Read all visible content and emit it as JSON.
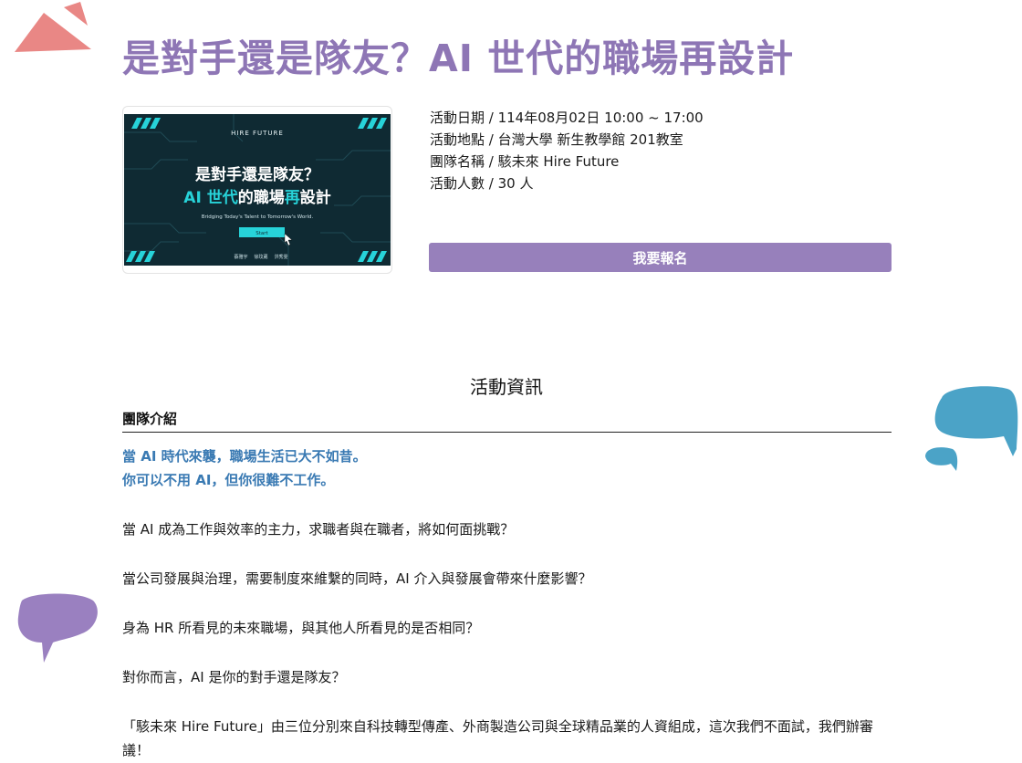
{
  "page": {
    "title": "是對手還是隊友？AI 世代的職場再設計"
  },
  "banner": {
    "brand": "HIRE FUTURE",
    "line1": "是對手還是隊友？",
    "line2_prefix": "AI ",
    "line2_highlight": "世代",
    "line2_mid": "的職場",
    "line2_highlight2": "再",
    "line2_suffix": "設計",
    "tagline": "Bridging Today's Talent to Tomorrow's World.",
    "start_label": "Start",
    "names": [
      "蔡雅宇",
      "徐玟葳",
      "洪秀雯"
    ]
  },
  "info": {
    "date": "活動日期 / 114年08月02日 10:00 ~ 17:00",
    "location": "活動地點 / 台灣大學 新生教學館 201教室",
    "team": "團隊名稱 / 駭未來 Hire Future",
    "capacity": "活動人數 / 30 人"
  },
  "register_label": "我要報名",
  "section_title": "活動資訊",
  "team_intro_heading": "團隊介紹",
  "intro": {
    "highlight1": "當 AI 時代來襲，職場生活已大不如昔。",
    "highlight2": "你可以不用 AI，但你很難不工作。",
    "q1": "當 AI 成為工作與效率的主力，求職者與在職者，將如何面挑戰？",
    "q2": "當公司發展與治理，需要制度來維繫的同時，AI 介入與發展會帶來什麼影響？",
    "q3": "身為 HR 所看見的未來職場，與其他人所看見的是否相同？",
    "q4": "對你而言，AI 是你的對手還是隊友？",
    "closing": "「駭未來 Hire Future」由三位分別來自科技轉型傳產、外商製造公司與全球精品業的人資組成，這次我們不面試，我們辦審議！"
  },
  "colors": {
    "title": "#8e76b5",
    "button": "#9780bb",
    "highlight": "#3a7ab3",
    "deco_pink": "#e98785",
    "deco_blue": "#4ba3c7",
    "deco_purple": "#9a80c0",
    "banner_accent": "#27d3d9"
  }
}
